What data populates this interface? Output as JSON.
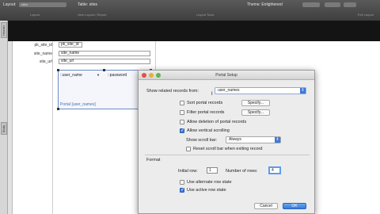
{
  "toolbar": {
    "layout_label": "Layout:",
    "layout_value": "sites",
    "table_label": "Table: sites",
    "theme_label": "Theme: Enlightened",
    "row2_left": "Layout",
    "row2_mid": "Layout Tools",
    "row2_midsub": "New Layout / Report",
    "row2_right": "Exit Layout"
  },
  "sidebar": {
    "header_tab": "Header",
    "body_tab": "Body"
  },
  "form": {
    "fields": [
      {
        "label": "pk_site_id",
        "value": "pk_site_id"
      },
      {
        "label": "site_name",
        "value": "site_name"
      },
      {
        "label": "site_url",
        "value": "site_url"
      }
    ]
  },
  "portal": {
    "field1": "::user_name",
    "field2": "::password",
    "caption": "Portal [user_names]"
  },
  "dialog": {
    "title": "Portal Setup",
    "related_label": "Show related records from:",
    "related_value": "user_names",
    "sort_label": "Sort portal records",
    "filter_label": "Filter portal records",
    "specify1": "Specify...",
    "specify2": "Specify...",
    "allow_delete_label": "Allow deletion of portal records",
    "allow_scroll_label": "Allow vertical scrolling",
    "scrollbar_label": "Show scroll bar:",
    "scrollbar_value": "Always",
    "reset_label": "Reset scroll bar when exiting record",
    "format_label": "Format",
    "initial_row_label": "Initial row:",
    "initial_row_value": "1",
    "num_rows_label": "Number of rows:",
    "num_rows_value": "4",
    "alt_state_label": "Use alternate row state",
    "active_state_label": "Use active row state",
    "cancel_label": "Cancel",
    "ok_label": "OK"
  }
}
